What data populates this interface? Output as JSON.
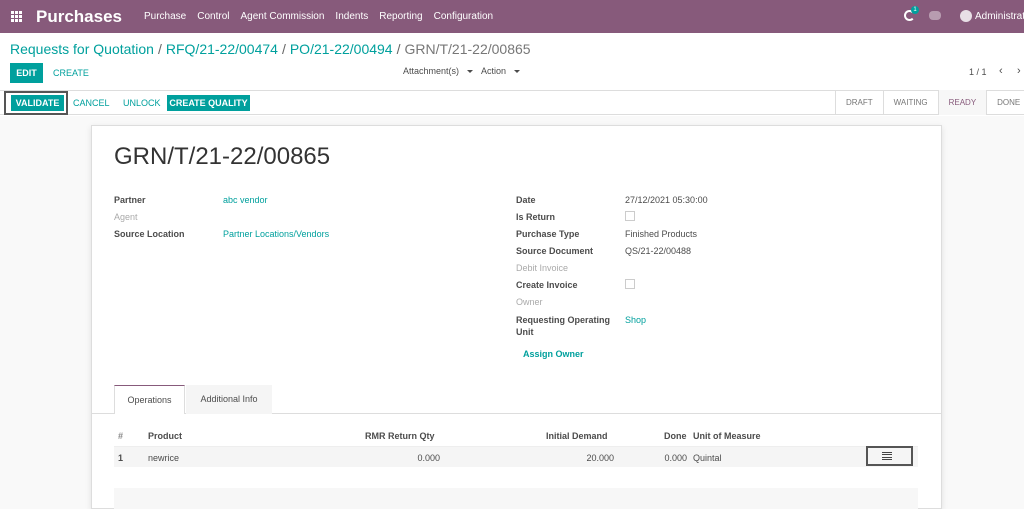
{
  "app": {
    "title": "Purchases",
    "menu": [
      "Purchase",
      "Control",
      "Agent Commission",
      "Indents",
      "Reporting",
      "Configuration"
    ],
    "activity_count": "1",
    "user": "Administrator",
    "accent": "#875a7b",
    "primary": "#00a09d"
  },
  "breadcrumb": {
    "items": [
      "Requests for Quotation",
      "RFQ/21-22/00474",
      "PO/21-22/00494"
    ],
    "current": "GRN/T/21-22/00865",
    "sep": "/"
  },
  "control": {
    "edit": "EDIT",
    "create": "CREATE",
    "attachments": "Attachment(s)",
    "action": "Action",
    "pager": "1 / 1",
    "prev": "‹",
    "next": "›"
  },
  "status": {
    "buttons": {
      "validate": "VALIDATE",
      "cancel": "CANCEL",
      "unlock": "UNLOCK",
      "create_quality": "CREATE QUALITY"
    },
    "stages": [
      "DRAFT",
      "WAITING",
      "READY",
      "DONE"
    ],
    "active_stage": "READY"
  },
  "form": {
    "title": "GRN/T/21-22/00865",
    "left": {
      "partner_label": "Partner",
      "partner_value": "abc vendor",
      "agent_label": "Agent",
      "source_location_label": "Source Location",
      "source_location_value": "Partner Locations/Vendors"
    },
    "right": {
      "date_label": "Date",
      "date_value": "27/12/2021 05:30:00",
      "is_return_label": "Is Return",
      "purchase_type_label": "Purchase Type",
      "purchase_type_value": "Finished Products",
      "source_document_label": "Source Document",
      "source_document_value": "QS/21-22/00488",
      "debit_invoice_label": "Debit Invoice",
      "create_invoice_label": "Create Invoice",
      "owner_label": "Owner",
      "req_unit_label_1": "Requesting Operating",
      "req_unit_label_2": "Unit",
      "req_unit_value": "Shop",
      "assign_owner": "Assign Owner"
    }
  },
  "tabs": [
    "Operations",
    "Additional Info"
  ],
  "table": {
    "headers": [
      "#",
      "Product",
      "RMR Return Qty",
      "Initial Demand",
      "Done",
      "Unit of Measure"
    ],
    "rows": [
      {
        "num": "1",
        "product": "newrice",
        "rmr_return_qty": "0.000",
        "initial_demand": "20.000",
        "done": "0.000",
        "uom": "Quintal"
      }
    ]
  }
}
